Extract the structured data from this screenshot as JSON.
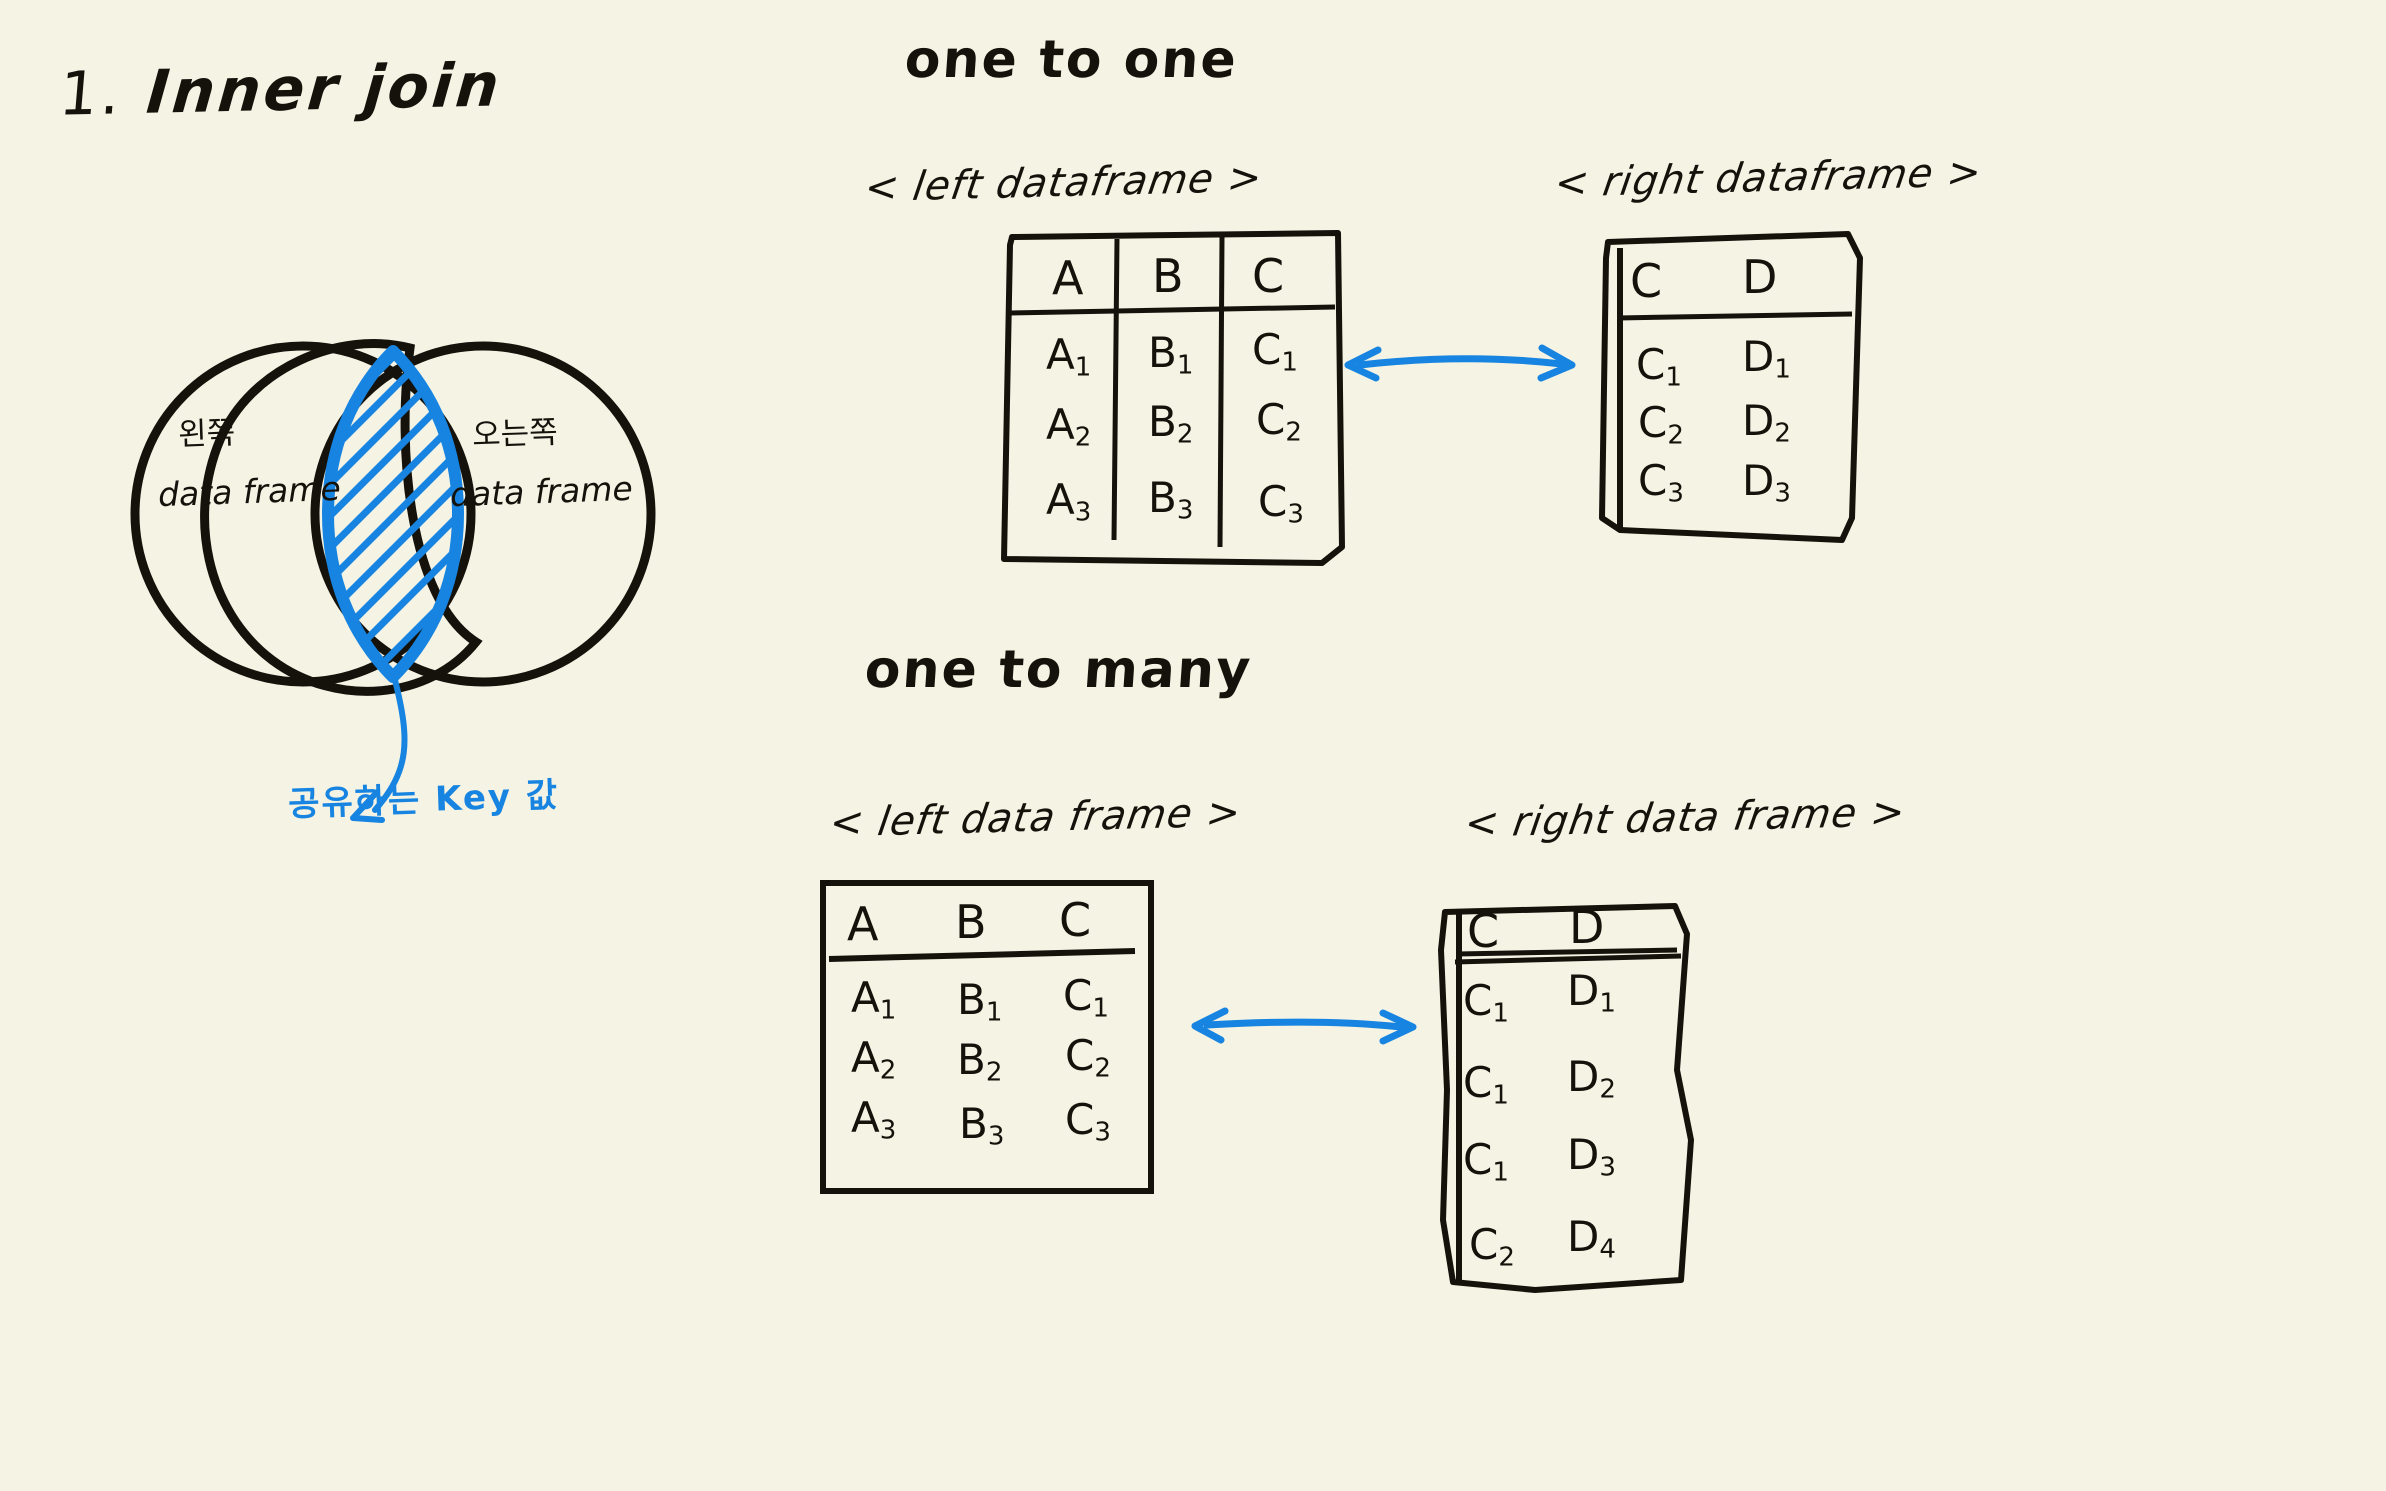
{
  "title": {
    "number": "1.",
    "text": "Inner join"
  },
  "venn": {
    "left_circle": {
      "label_ko": "왼쪽",
      "label_en": "data frame"
    },
    "right_circle": {
      "label_ko": "오는쪽",
      "label_en": "data frame"
    },
    "intersection_note": "공유하는  Key 값",
    "intersection_color": "#1684e0",
    "circle_stroke_color": "#15120c"
  },
  "sections": [
    {
      "heading": "one to one",
      "arrow": {
        "type": "double-headed",
        "color": "#1684e0"
      },
      "left_table": {
        "caption": "< left dataframe >",
        "columns": [
          "A",
          "B",
          "C"
        ],
        "rows": [
          [
            "A1",
            "B1",
            "C1"
          ],
          [
            "A2",
            "B2",
            "C2"
          ],
          [
            "A3",
            "B3",
            "C3"
          ]
        ]
      },
      "right_table": {
        "caption": "< right dataframe >",
        "columns": [
          "C",
          "D"
        ],
        "rows": [
          [
            "C1",
            "D1"
          ],
          [
            "C2",
            "D2"
          ],
          [
            "C3",
            "D3"
          ]
        ]
      }
    },
    {
      "heading": "one to many",
      "arrow": {
        "type": "double-headed",
        "color": "#1684e0"
      },
      "left_table": {
        "caption": "< left data frame >",
        "columns": [
          "A",
          "B",
          "C"
        ],
        "rows": [
          [
            "A1",
            "B1",
            "C1"
          ],
          [
            "A2",
            "B2",
            "C2"
          ],
          [
            "A3",
            "B3",
            "C3"
          ]
        ]
      },
      "right_table": {
        "caption": "< right data frame >",
        "columns": [
          "C",
          "D"
        ],
        "rows": [
          [
            "C1",
            "D1"
          ],
          [
            "C1",
            "D2"
          ],
          [
            "C1",
            "D3"
          ],
          [
            "C2",
            "D4"
          ]
        ]
      }
    }
  ],
  "canvas": {
    "background_color": "#f5f3e4",
    "ink_color": "#15120c",
    "accent_color": "#1684e0"
  }
}
